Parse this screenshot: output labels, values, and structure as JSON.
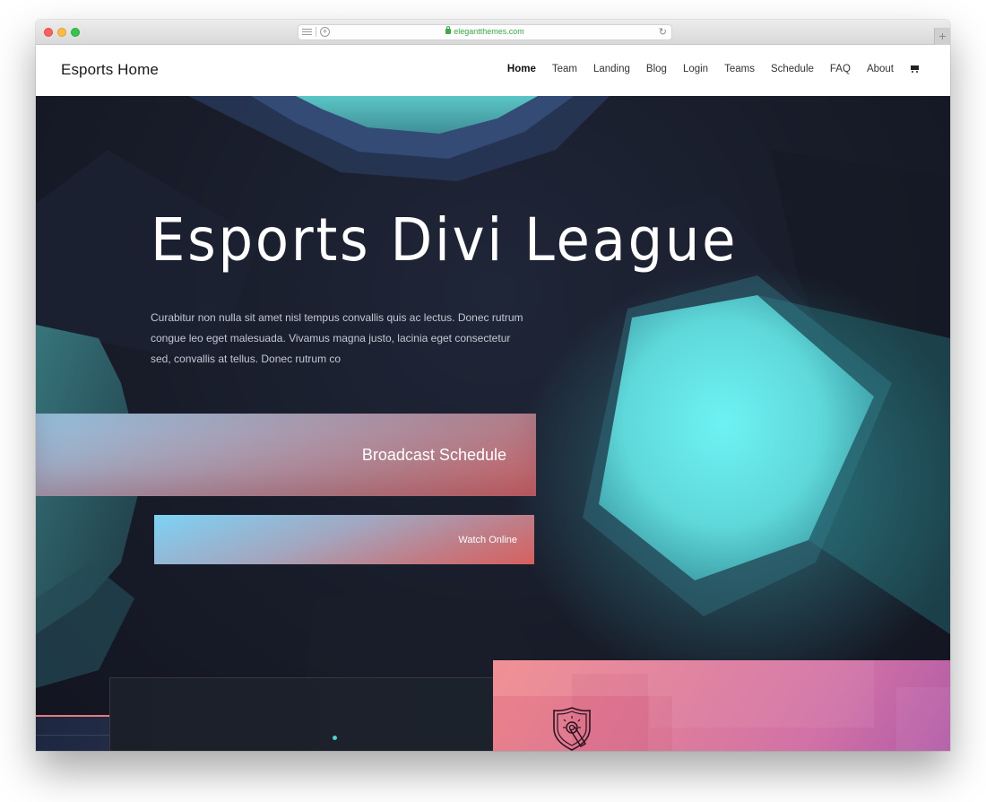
{
  "browser": {
    "url": "elegantthemes.com",
    "new_tab_label": "+"
  },
  "site": {
    "logo": "Esports Home",
    "nav": [
      {
        "label": "Home",
        "active": true
      },
      {
        "label": "Team"
      },
      {
        "label": "Landing"
      },
      {
        "label": "Blog"
      },
      {
        "label": "Login"
      },
      {
        "label": "Teams"
      },
      {
        "label": "Schedule"
      },
      {
        "label": "FAQ"
      },
      {
        "label": "About"
      }
    ],
    "cart_icon": "shopping-cart-icon"
  },
  "hero": {
    "title": "Esports Divi League",
    "description": "Curabitur non nulla sit amet nisl tempus convallis quis ac lectus. Donec rutrum congue leo eget malesuada. Vivamus magna justo, lacinia eget consectetur sed, convallis at tellus. Donec rutrum co",
    "primary_button": "Broadcast Schedule",
    "secondary_button": "Watch Online"
  },
  "colors": {
    "accent_teal": "#6ef0f0",
    "accent_coral": "#d7605e",
    "accent_sky": "#7dd2f5",
    "accent_pink": "#d272a6",
    "background_dark": "#181c29"
  },
  "icons": {
    "feature_card": "shield-touch-icon"
  }
}
